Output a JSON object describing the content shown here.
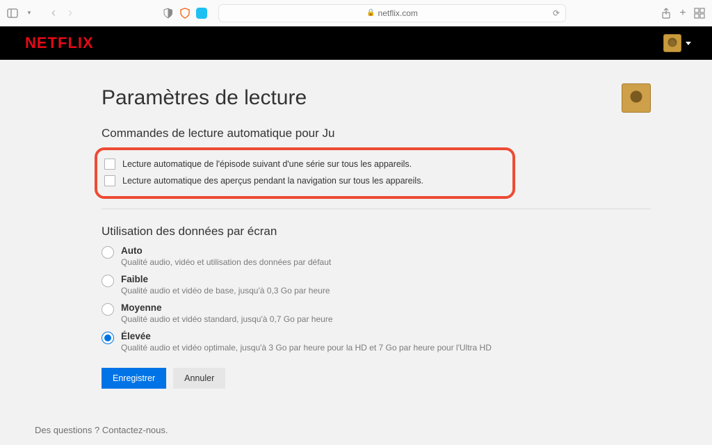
{
  "browser": {
    "url_host": "netflix.com"
  },
  "header": {
    "logo_text": "NETFLIX"
  },
  "page": {
    "title": "Paramètres de lecture",
    "autoplay": {
      "title": "Commandes de lecture automatique pour Ju",
      "options": [
        {
          "label": "Lecture automatique de l'épisode suivant d'une série sur tous les appareils.",
          "checked": false
        },
        {
          "label": "Lecture automatique des aperçus pendant la navigation sur tous les appareils.",
          "checked": false
        }
      ]
    },
    "data_usage": {
      "title": "Utilisation des données par écran",
      "options": [
        {
          "label": "Auto",
          "desc": "Qualité audio, vidéo et utilisation des données par défaut",
          "selected": false
        },
        {
          "label": "Faible",
          "desc": "Qualité audio et vidéo de base, jusqu'à 0,3 Go par heure",
          "selected": false
        },
        {
          "label": "Moyenne",
          "desc": "Qualité audio et vidéo standard, jusqu'à 0,7 Go par heure",
          "selected": false
        },
        {
          "label": "Élevée",
          "desc": "Qualité audio et vidéo optimale, jusqu'à 3 Go par heure pour la HD et 7 Go par heure pour l'Ultra HD",
          "selected": true
        }
      ]
    },
    "buttons": {
      "save": "Enregistrer",
      "cancel": "Annuler"
    }
  },
  "footer": {
    "text": "Des questions ? Contactez-nous."
  }
}
